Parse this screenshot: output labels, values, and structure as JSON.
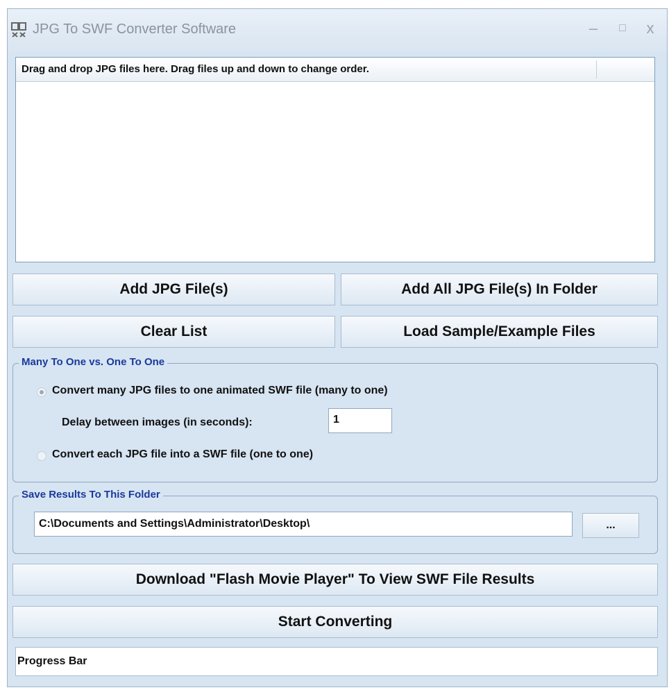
{
  "window": {
    "title": "JPG To SWF Converter Software",
    "controls": {
      "minimize": "–",
      "maximize": "□",
      "close": "x"
    }
  },
  "file_list": {
    "header": "Drag and drop JPG files here. Drag files up and down to change order.",
    "items": []
  },
  "buttons": {
    "add_files": "Add JPG File(s)",
    "add_folder": "Add All JPG File(s) In Folder",
    "clear_list": "Clear List",
    "load_sample": "Load Sample/Example Files",
    "download_player": "Download \"Flash Movie Player\" To View SWF File Results",
    "start_converting": "Start Converting",
    "browse": "..."
  },
  "mode_group": {
    "legend": "Many To One vs. One To One",
    "many_to_one_label": "Convert many JPG files to one animated SWF file (many to one)",
    "many_to_one_checked": true,
    "delay_label": "Delay between images (in seconds):",
    "delay_value": "1",
    "one_to_one_label": "Convert each JPG file into a SWF file (one to one)",
    "one_to_one_checked": false
  },
  "save_group": {
    "legend": "Save Results To This Folder",
    "folder_path": "C:\\Documents and Settings\\Administrator\\Desktop\\"
  },
  "progress": {
    "label": "Progress Bar",
    "value": 0
  },
  "colors": {
    "window_bg": "#d7e4f2",
    "legend_text": "#1a3a9a",
    "button_border": "#a9bccf"
  }
}
